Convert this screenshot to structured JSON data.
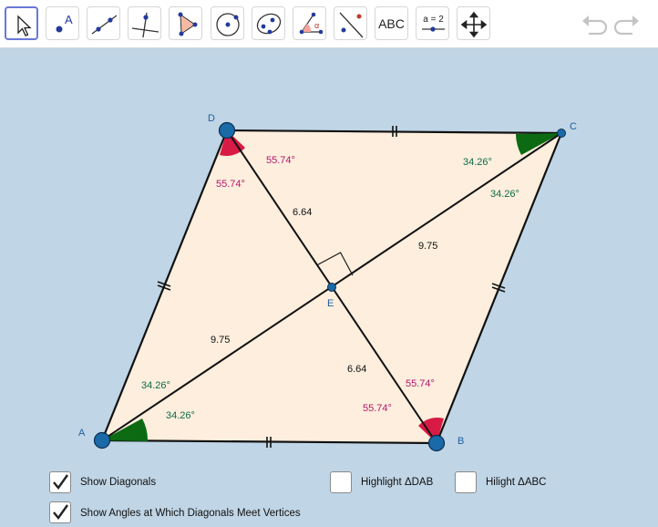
{
  "toolbar": {
    "tools": [
      {
        "name": "move-tool",
        "label": ""
      },
      {
        "name": "point-tool",
        "label": "A"
      },
      {
        "name": "line-tool",
        "label": ""
      },
      {
        "name": "perpendicular-line-tool",
        "label": ""
      },
      {
        "name": "polygon-tool",
        "label": ""
      },
      {
        "name": "circle-center-point-tool",
        "label": ""
      },
      {
        "name": "ellipse-tool",
        "label": ""
      },
      {
        "name": "angle-tool",
        "label": "α"
      },
      {
        "name": "reflect-tool",
        "label": ""
      },
      {
        "name": "text-tool",
        "label": "ABC"
      },
      {
        "name": "slider-tool",
        "label": "a = 2"
      },
      {
        "name": "move-graphics-view-tool",
        "label": ""
      }
    ],
    "undo_icon": "undo-icon",
    "redo_icon": "redo-icon"
  },
  "geometry": {
    "vertices": {
      "A": "A",
      "B": "B",
      "C": "C",
      "D": "D",
      "E": "E"
    },
    "segments": {
      "half_diagonal_AC": "9.75",
      "half_diagonal_BD": "6.64"
    },
    "angles": {
      "at_B_and_D": "55.74°",
      "at_A_and_C": "34.26°"
    },
    "colors": {
      "fill": "#fdeedd",
      "angle_BD": "#d81b45",
      "angle_AC": "#0b6a12",
      "point": "#1a6aa8"
    }
  },
  "checkboxes": {
    "show_diagonals": {
      "label": "Show Diagonals",
      "checked": true
    },
    "highlight_dab": {
      "label": "Highlight ΔDAB",
      "checked": false
    },
    "hilight_abc": {
      "label": "Hilight ΔABC",
      "checked": false
    },
    "show_angles": {
      "label": "Show Angles at Which Diagonals Meet Vertices",
      "checked": true
    }
  }
}
